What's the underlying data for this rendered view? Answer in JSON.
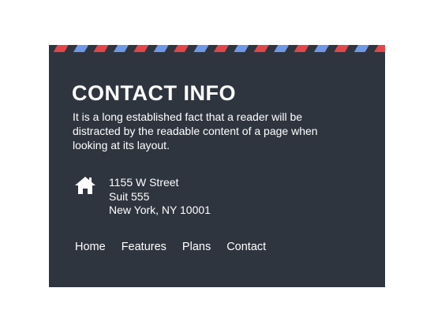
{
  "contact": {
    "title": "CONTACT INFO",
    "description": "It is a long established fact that a reader will be distracted by the readable content of a page when looking at its layout.",
    "address": {
      "icon": "home-icon",
      "line1": "1155 W Street",
      "line2": "Suit 555",
      "line3": "New York, NY 10001"
    }
  },
  "nav": {
    "items": [
      {
        "label": "Home"
      },
      {
        "label": "Features"
      },
      {
        "label": "Plans"
      },
      {
        "label": "Contact"
      }
    ]
  },
  "colors": {
    "card_background": "#2f353f",
    "stripe_red": "#e1464a",
    "stripe_blue": "#6f98e6",
    "text": "#ffffff"
  }
}
